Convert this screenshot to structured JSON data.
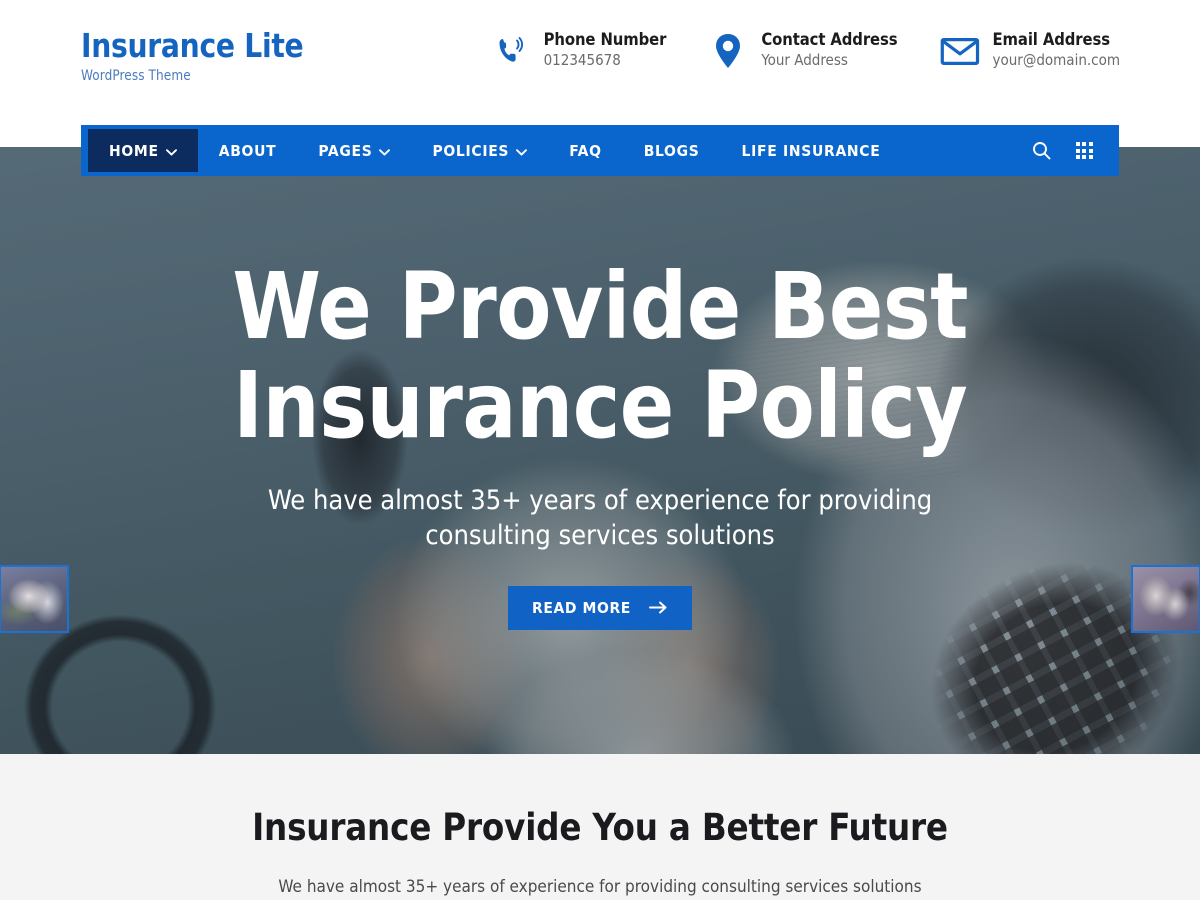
{
  "header": {
    "brand_title": "Insurance Lite",
    "brand_subtitle": "WordPress Theme",
    "contacts": [
      {
        "icon": "phone-ringing-icon",
        "label": "Phone Number",
        "value": "012345678"
      },
      {
        "icon": "map-pin-icon",
        "label": "Contact Address",
        "value": "Your Address"
      },
      {
        "icon": "envelope-icon",
        "label": "Email Address",
        "value": "your@domain.com"
      }
    ]
  },
  "nav": {
    "items": [
      {
        "label": "HOME",
        "has_dropdown": true,
        "active": true
      },
      {
        "label": "ABOUT",
        "has_dropdown": false,
        "active": false
      },
      {
        "label": "PAGES",
        "has_dropdown": true,
        "active": false
      },
      {
        "label": "POLICIES",
        "has_dropdown": true,
        "active": false
      },
      {
        "label": "FAQ",
        "has_dropdown": false,
        "active": false
      },
      {
        "label": "BLOGS",
        "has_dropdown": false,
        "active": false
      },
      {
        "label": "LIFE INSURANCE",
        "has_dropdown": false,
        "active": false
      }
    ],
    "search_icon": "search-icon",
    "grid_icon": "grid-menu-icon"
  },
  "hero": {
    "title_line1": "We Provide Best",
    "title_line2": "Insurance Policy",
    "subtitle": "We have almost 35+ years of experience for providing consulting services solutions",
    "cta_label": "READ MORE",
    "cta_arrow": "arrow-right-icon",
    "thumb_left_alt": "wedding-couple-slide",
    "thumb_right_alt": "grandmother-child-slide"
  },
  "below": {
    "title": "Insurance Provide You a Better Future",
    "subtitle": "We have almost 35+ years of experience for providing consulting services solutions"
  },
  "colors": {
    "brand_blue": "#1565C0",
    "nav_blue": "#0A66CC",
    "nav_active_navy": "#0C2B5E",
    "button_blue": "#1062C4",
    "section_bg": "#F4F4F4"
  }
}
